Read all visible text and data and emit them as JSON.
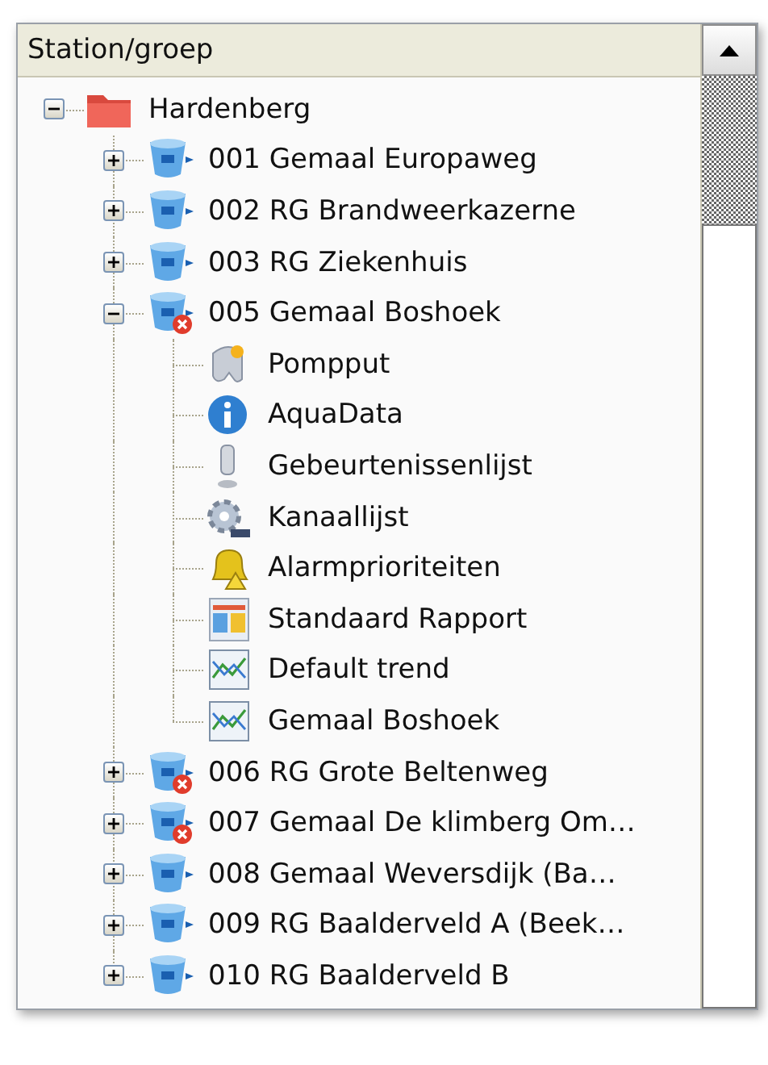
{
  "header": "Station/groep",
  "tree": [
    {
      "label": "Hardenberg",
      "kind": "folder",
      "expanded": true,
      "children": [
        {
          "label": "001 Gemaal Europaweg",
          "kind": "station",
          "alarm": false,
          "expanded": false
        },
        {
          "label": "002 RG Brandweerkazerne",
          "kind": "station",
          "alarm": false,
          "expanded": false
        },
        {
          "label": "003 RG Ziekenhuis",
          "kind": "station",
          "alarm": false,
          "expanded": false
        },
        {
          "label": "005 Gemaal Boshoek",
          "kind": "station",
          "alarm": true,
          "expanded": true,
          "children": [
            {
              "label": "Pompput",
              "kind": "pit"
            },
            {
              "label": "AquaData",
              "kind": "info"
            },
            {
              "label": "Gebeurtenissenlijst",
              "kind": "events"
            },
            {
              "label": "Kanaallijst",
              "kind": "channels"
            },
            {
              "label": "Alarmprioriteiten",
              "kind": "bell"
            },
            {
              "label": "Standaard Rapport",
              "kind": "report"
            },
            {
              "label": "Default trend",
              "kind": "trend"
            },
            {
              "label": "Gemaal Boshoek",
              "kind": "trend"
            }
          ]
        },
        {
          "label": "006 RG Grote Beltenweg",
          "kind": "station",
          "alarm": true,
          "expanded": false
        },
        {
          "label": "007 Gemaal De klimberg Om…",
          "kind": "station",
          "alarm": true,
          "expanded": false
        },
        {
          "label": "008 Gemaal Weversdijk (Ba…",
          "kind": "station",
          "alarm": false,
          "expanded": false
        },
        {
          "label": "009 RG Baalderveld A (Beek…",
          "kind": "station",
          "alarm": false,
          "expanded": false
        },
        {
          "label": "010 RG Baalderveld B",
          "kind": "station",
          "alarm": false,
          "expanded": false
        }
      ]
    }
  ]
}
